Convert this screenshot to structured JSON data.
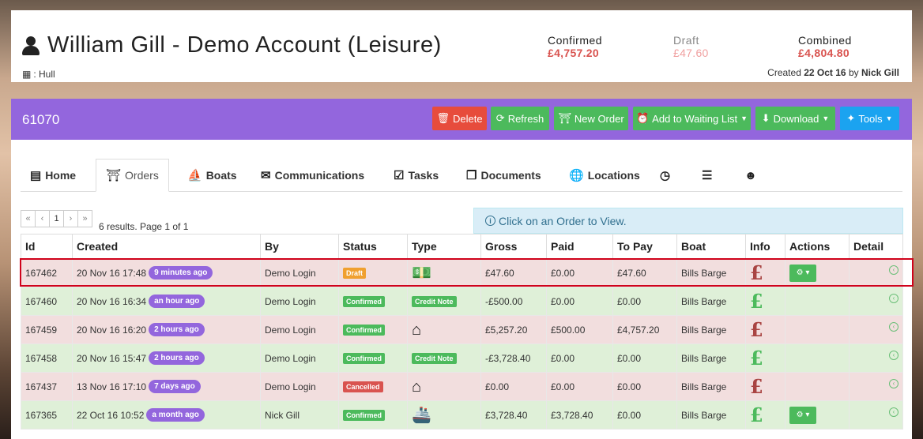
{
  "account": {
    "title": "William Gill - Demo Account (Leisure)",
    "location": ": Hull",
    "created_prefix": "Created",
    "created_date": "22 Oct 16",
    "created_by_word": "by",
    "created_by": "Nick Gill"
  },
  "summary": {
    "confirmed_label": "Confirmed",
    "confirmed_value": "£4,757.20",
    "draft_label": "Draft",
    "draft_value": "£47.60",
    "combined_label": "Combined",
    "combined_value": "£4,804.80"
  },
  "panel": {
    "order_ref": "61070",
    "buttons": {
      "delete": "Delete",
      "refresh": "Refresh",
      "new_order": "New Order",
      "waiting_list": "Add to Waiting List",
      "download": "Download",
      "tools": "Tools"
    }
  },
  "tabs": {
    "home": "Home",
    "orders": "Orders",
    "boats": "Boats",
    "communications": "Communications",
    "tasks": "Tasks",
    "documents": "Documents",
    "locations": "Locations"
  },
  "pager": {
    "first": "«",
    "prev": "‹",
    "current": "1",
    "next": "›",
    "last": "»",
    "results": "6 results. Page 1 of 1"
  },
  "info": "Click on an Order to View.",
  "table": {
    "headers": [
      "Id",
      "Created",
      "By",
      "Status",
      "Type",
      "Gross",
      "Paid",
      "To Pay",
      "Boat",
      "Info",
      "Actions",
      "Detail"
    ],
    "rows": [
      {
        "id": "167462",
        "created": "20 Nov 16 17:48",
        "ago": "9 minutes ago",
        "by": "Demo Login",
        "status": "Draft",
        "type": "money",
        "gross": "£47.60",
        "paid": "£0.00",
        "to_pay": "£47.60",
        "boat": "Bills Barge",
        "info": "£"
      },
      {
        "id": "167460",
        "created": "20 Nov 16 16:34",
        "ago": "an hour ago",
        "by": "Demo Login",
        "status": "Confirmed",
        "type": "Credit Note",
        "gross": "-£500.00",
        "paid": "£0.00",
        "to_pay": "£0.00",
        "boat": "Bills Barge",
        "info": "£"
      },
      {
        "id": "167459",
        "created": "20 Nov 16 16:20",
        "ago": "2 hours ago",
        "by": "Demo Login",
        "status": "Confirmed",
        "type": "home",
        "gross": "£5,257.20",
        "paid": "£500.00",
        "to_pay": "£4,757.20",
        "boat": "Bills Barge",
        "info": "£"
      },
      {
        "id": "167458",
        "created": "20 Nov 16 15:47",
        "ago": "2 hours ago",
        "by": "Demo Login",
        "status": "Confirmed",
        "type": "Credit Note",
        "gross": "-£3,728.40",
        "paid": "£0.00",
        "to_pay": "£0.00",
        "boat": "Bills Barge",
        "info": "£"
      },
      {
        "id": "167437",
        "created": "13 Nov 16 17:10",
        "ago": "7 days ago",
        "by": "Demo Login",
        "status": "Cancelled",
        "type": "home",
        "gross": "£0.00",
        "paid": "£0.00",
        "to_pay": "£0.00",
        "boat": "Bills Barge",
        "info": "£"
      },
      {
        "id": "167365",
        "created": "22 Oct 16 10:52",
        "ago": "a month ago",
        "by": "Nick Gill",
        "status": "Confirmed",
        "type": "boat",
        "gross": "£3,728.40",
        "paid": "£3,728.40",
        "to_pay": "£0.00",
        "boat": "Bills Barge",
        "info": "£"
      }
    ]
  }
}
